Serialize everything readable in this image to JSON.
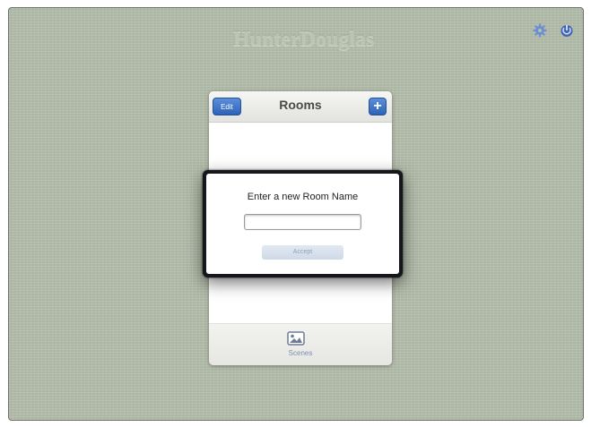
{
  "app": {
    "brand": "HunterDouglas",
    "settings_icon": "gear-icon",
    "power_icon": "power-icon",
    "icon_color": "#3b63b6"
  },
  "panel": {
    "title": "Rooms",
    "edit_label": "Edit",
    "add_label": "+",
    "footer": {
      "icon": "picture-icon",
      "label": "Scenes"
    }
  },
  "dialog": {
    "title": "Enter a new Room Name",
    "input_value": "",
    "input_placeholder": "",
    "accept_label": "Accept"
  }
}
